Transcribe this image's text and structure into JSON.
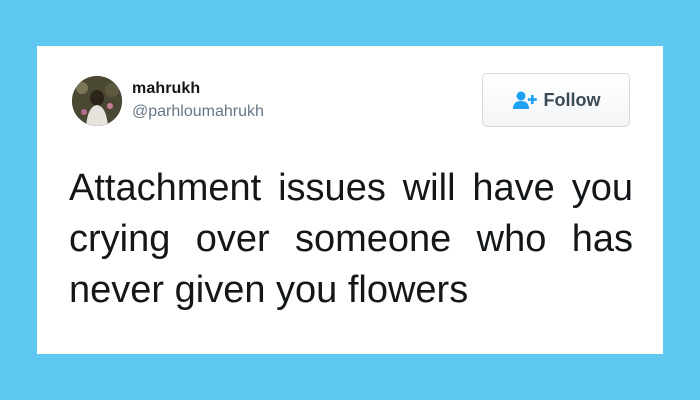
{
  "tweet": {
    "display_name": "mahrukh",
    "handle": "@parhloumahrukh",
    "text": "Attachment issues will have you crying over someone who has never given you flowers",
    "follow_label": "Follow"
  },
  "icons": {
    "avatar": "profile-photo",
    "follow": "add-user-icon"
  },
  "colors": {
    "background": "#5ec8f0",
    "card": "#ffffff",
    "accent": "#1da1f2",
    "handle": "#657786",
    "text": "#14171a"
  }
}
